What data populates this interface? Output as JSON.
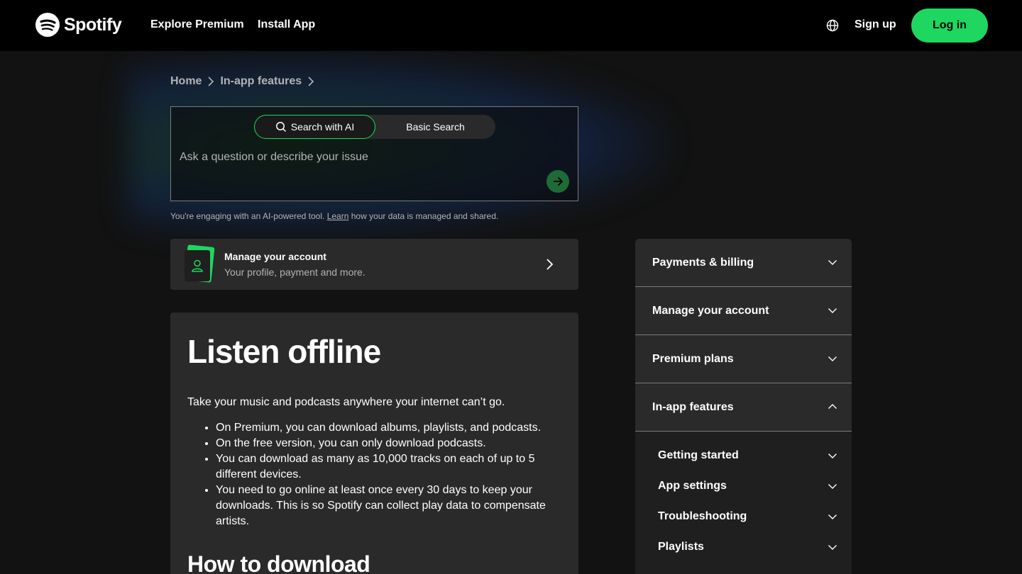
{
  "header": {
    "brand": "Spotify",
    "nav": [
      "Explore Premium",
      "Install App"
    ],
    "signup_label": "Sign up",
    "login_label": "Log in"
  },
  "breadcrumb": [
    "Home",
    "In-app features"
  ],
  "search": {
    "tabs": [
      "Search with AI",
      "Basic Search"
    ],
    "active_tab": "Search with AI",
    "placeholder": "Ask a question or describe your issue",
    "value": ""
  },
  "disclaimer": {
    "before": "You're engaging with an AI-powered tool.",
    "link": "Learn",
    "after": "how your data is managed and shared."
  },
  "account_card": {
    "title": "Manage your account",
    "subtitle": "Your profile, payment and more."
  },
  "article": {
    "title": "Listen offline",
    "lead": "Take your music and podcasts anywhere your internet can’t go.",
    "bullets": [
      "On Premium, you can download albums, playlists, and podcasts.",
      "On the free version, you can only download podcasts.",
      "You can download as many as 10,000 tracks on each of up to 5 different devices.",
      "You need to go online at least once every 30 days to keep your downloads. This is so Spotify can collect play data to compensate artists."
    ],
    "section_heading": "How to download"
  },
  "sidebar": {
    "categories": [
      {
        "label": "Payments & billing",
        "expanded": false
      },
      {
        "label": "Manage your account",
        "expanded": false
      },
      {
        "label": "Premium plans",
        "expanded": false
      },
      {
        "label": "In-app features",
        "expanded": true
      }
    ],
    "subitems": [
      "Getting started",
      "App settings",
      "Troubleshooting",
      "Playlists"
    ]
  },
  "colors": {
    "accent": "#1ed760",
    "background": "#121212",
    "card": "#2a2a2a",
    "header": "#000000"
  }
}
